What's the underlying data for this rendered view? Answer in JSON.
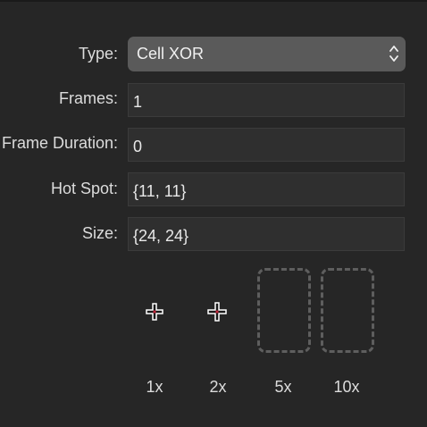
{
  "form": {
    "type_label": "Type:",
    "type_value": "Cell XOR",
    "frames_label": "Frames:",
    "frames_value": "1",
    "frame_duration_label": "Frame Duration:",
    "frame_duration_value": "0",
    "hot_spot_label": "Hot Spot:",
    "hot_spot_value": "{11, 11}",
    "size_label": "Size:",
    "size_value": "{24, 24}"
  },
  "previews": {
    "labels": [
      "1x",
      "2x",
      "5x",
      "10x"
    ],
    "wells": [
      {
        "scale": "1x",
        "icon": "crosshair-cursor-icon",
        "filled": true
      },
      {
        "scale": "2x",
        "icon": "crosshair-cursor-icon",
        "filled": true
      },
      {
        "scale": "5x",
        "icon": "empty-well",
        "filled": false
      },
      {
        "scale": "10x",
        "icon": "empty-well",
        "filled": false
      }
    ]
  },
  "colors": {
    "background": "#262626",
    "field_background": "#2f2f2f",
    "popup_background": "#5a5a5a",
    "hotspot_dot": "#c0263a"
  }
}
